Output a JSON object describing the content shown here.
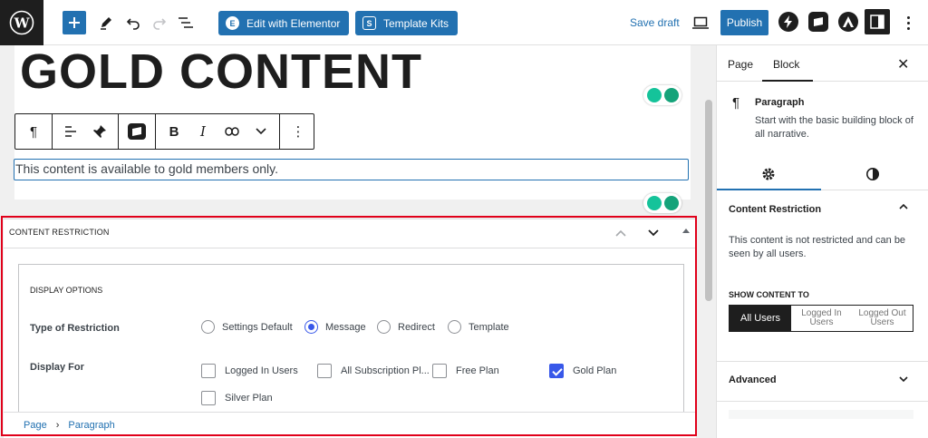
{
  "topbar": {
    "edit_elementor_label": "Edit with Elementor",
    "template_kits_label": "Template Kits",
    "save_draft_label": "Save draft",
    "publish_label": "Publish"
  },
  "editor": {
    "heading": "GOLD CONTENT",
    "paragraph": "This content is available to gold members only."
  },
  "metabox": {
    "title": "CONTENT RESTRICTION",
    "display_options_title": "DISPLAY OPTIONS",
    "type_label": "Type of Restriction",
    "type_options": [
      "Settings Default",
      "Message",
      "Redirect",
      "Template"
    ],
    "type_selected": "Message",
    "display_for_label": "Display For",
    "display_for_options": [
      {
        "label": "Logged In Users",
        "checked": false
      },
      {
        "label": "All Subscription Pl...",
        "checked": false
      },
      {
        "label": "Free Plan",
        "checked": false
      },
      {
        "label": "Gold Plan",
        "checked": true
      },
      {
        "label": "Silver Plan",
        "checked": false
      }
    ]
  },
  "breadcrumb": {
    "items": [
      "Page",
      "Paragraph"
    ]
  },
  "sidebar": {
    "tabs": [
      "Page",
      "Block"
    ],
    "active_tab": "Block",
    "block_title": "Paragraph",
    "block_description": "Start with the basic building block of all narrative.",
    "content_restriction_title": "Content Restriction",
    "content_restriction_desc": "This content is not restricted and can be seen by all users.",
    "show_content_to_label": "SHOW CONTENT TO",
    "segments": [
      "All Users",
      "Logged In Users",
      "Logged Out Users"
    ],
    "active_segment": "All Users",
    "advanced_title": "Advanced"
  },
  "colors": {
    "accent": "#2271b1",
    "checkbox_accent": "#3858e9",
    "highlight": "#e0001a",
    "dark": "#1e1e1e"
  }
}
